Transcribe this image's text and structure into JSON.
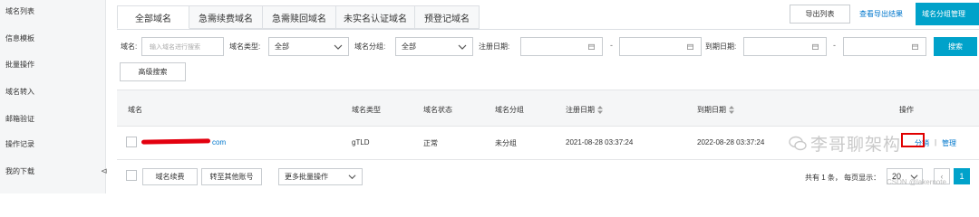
{
  "sidebar": {
    "items": [
      {
        "label": "域名列表"
      },
      {
        "label": "信息模板"
      },
      {
        "label": "批量操作"
      },
      {
        "label": "域名转入"
      },
      {
        "label": "邮箱验证"
      },
      {
        "label": "操作记录"
      },
      {
        "label": "我的下载"
      }
    ],
    "collapse_glyph": "⊲"
  },
  "tabs": [
    {
      "label": "全部域名"
    },
    {
      "label": "急需续费域名"
    },
    {
      "label": "急需赎回域名"
    },
    {
      "label": "未实名认证域名"
    },
    {
      "label": "预登记域名"
    }
  ],
  "header_actions": {
    "export_list": "导出列表",
    "view_export_results": "查看导出结果",
    "group_manage": "域名分组管理"
  },
  "filters": {
    "domain_label": "域名:",
    "domain_placeholder": "输入域名进行搜索",
    "type_label": "域名类型:",
    "type_value": "全部",
    "group_label": "域名分组:",
    "group_value": "全部",
    "reg_date_label": "注册日期:",
    "expire_date_label": "到期日期:",
    "range_sep": "-",
    "search_button": "搜索",
    "advanced_search": "高级搜索"
  },
  "table": {
    "columns": [
      "域名",
      "域名类型",
      "域名状态",
      "域名分组",
      "注册日期",
      "到期日期",
      "操作"
    ],
    "rows": [
      {
        "domain_suffix": "com",
        "type": "gTLD",
        "status": "正常",
        "group": "未分组",
        "reg_date": "2021-08-28 03:37:24",
        "expire_date": "2022-08-28 03:37:24",
        "actions": [
          "分销",
          "管理"
        ],
        "action_sep": "|"
      }
    ]
  },
  "footer": {
    "renew_button": "域名续费",
    "transfer_button": "转至其他账号",
    "more_batch": "更多批量操作",
    "pager_text": "共有 1 条， 每页显示：",
    "page_size": "20",
    "prev_glyph": "‹",
    "current_page": "1"
  },
  "watermark": {
    "text": "李哥聊架构",
    "csdn": "CSDN @lakernote"
  },
  "colors": {
    "primary": "#00a2ca",
    "link": "#0077cc",
    "redaction": "#e3000f"
  }
}
